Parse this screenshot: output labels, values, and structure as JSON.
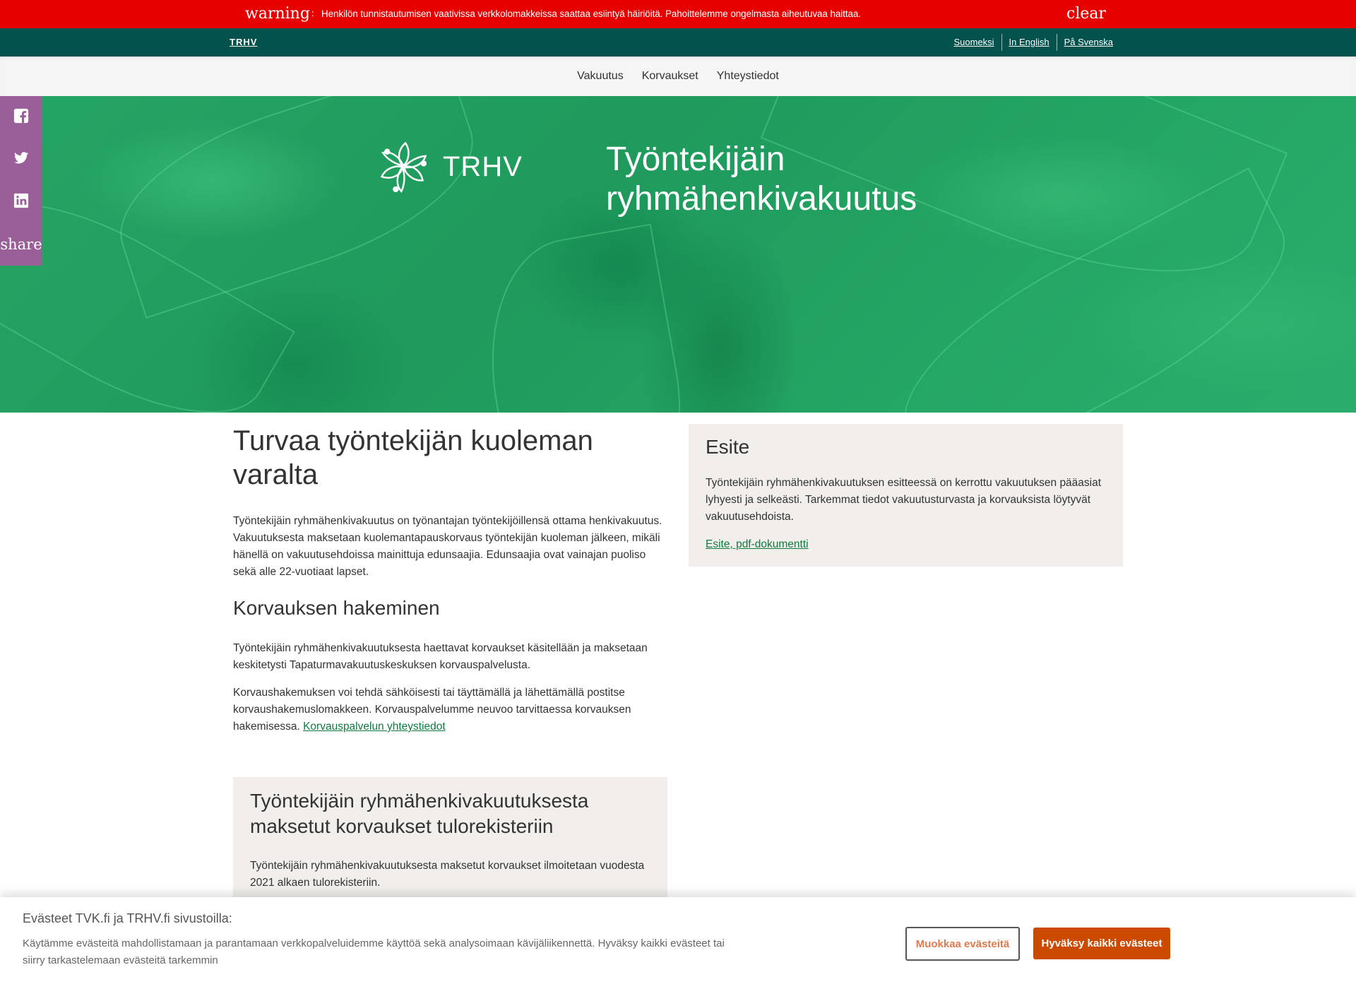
{
  "alert": {
    "icon": "warning",
    "icon_semantic": "warning-icon",
    "separator": ":",
    "message": "Henkilön tunnistautumisen vaativissa verkkolomakkeissa saattaa esiintyä häiriöitä. Pahoittelemme ongelmasta aiheutuvaa haittaa.",
    "close_icon": "clear",
    "close_semantic": "close-icon",
    "color": "#e60000"
  },
  "util_bar": {
    "brand": "TRHV",
    "languages": [
      "Suomeksi",
      "In English",
      "På Svenska"
    ],
    "color": "#03524d"
  },
  "nav": {
    "items": [
      "Vakuutus",
      "Korvaukset",
      "Yhteystiedot"
    ]
  },
  "share": {
    "icons": [
      "facebook-icon",
      "twitter-icon",
      "linkedin-icon"
    ],
    "label": "share",
    "color": "#9a5e99"
  },
  "hero": {
    "logo_text": "TRHV",
    "title_line1": "Työntekijäin",
    "title_line2": "ryhmähenkivakuutus"
  },
  "main": {
    "title": "Turvaa työntekijän kuoleman varalta",
    "intro": "Työntekijäin ryhmähenkivakuutus on työnantajan työntekijöillensä ottama henkivakuutus. Vakuutuksesta maksetaan kuolemantapauskorvaus työntekijän kuoleman jälkeen, mikäli hänellä on vakuutusehdoissa mainittuja edunsaajia. Edunsaajia ovat vainajan puoliso sekä alle 22-vuotiaat lapset.",
    "section_title": "Korvauksen hakeminen",
    "section_p1": "Työntekijäin ryhmähenkivakuutuksesta haettavat korvaukset käsitellään ja maksetaan keskitetysti Tapaturmavakuutuskeskuksen korvauspalvelusta.",
    "section_p2": "Korvaushakemuksen voi tehdä sähköisesti tai täyttämällä ja lähettämällä postitse korvaushakemuslomakkeen. Korvauspalvelumme neuvoo tarvittaessa korvauksen hakemisessa.",
    "section_link": "Korvauspalvelun yhteystiedot"
  },
  "esite": {
    "title": "Esite",
    "text": "Työntekijäin ryhmähenkivakuutuksen esitteessä on kerrottu vakuutuksen pääasiat lyhyesti ja selkeästi. Tarkemmat tiedot vakuutusturvasta ja korvauksista löytyvät vakuutusehdoista.",
    "link": "Esite, pdf-dokumentti"
  },
  "tulorekisteri": {
    "title": "Työntekijäin ryhmähenkivakuutuksesta maksetut korvaukset tulorekisteriin",
    "text": "Työntekijäin ryhmähenkivakuutuksesta maksetut korvaukset ilmoitetaan vuodesta 2021 alkaen tulorekisteriin."
  },
  "cookie": {
    "title": "Evästeet TVK.fi ja TRHV.fi sivustoilla:",
    "text": "Käytämme evästeitä mahdollistamaan ja parantamaan verkkopalveluidemme käyttöä sekä analysoimaan kävijäliikennettä. Hyväksy kaikki evästeet tai siirry tarkastelemaan evästeitä tarkemmin",
    "customize_label": "Muokkaa evästeitä",
    "accept_label": "Hyväksy kaikki evästeet",
    "accent_color": "#cc4a00"
  },
  "colors": {
    "link_green": "#0f7b40",
    "box_bg": "#f1eeeb"
  }
}
